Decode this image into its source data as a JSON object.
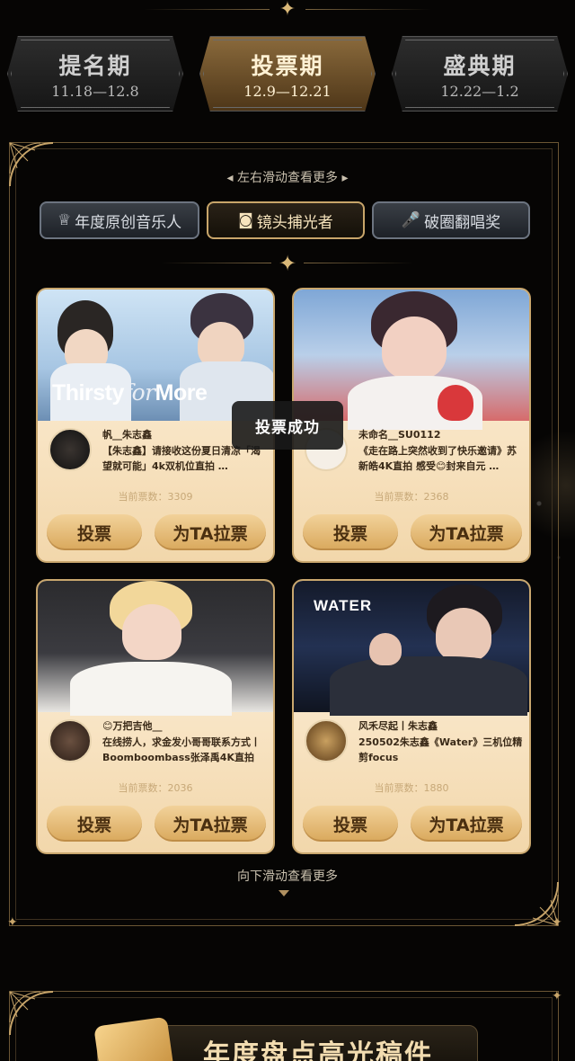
{
  "phases": [
    {
      "name": "提名期",
      "date": "11.18—12.8"
    },
    {
      "name": "投票期",
      "date": "12.9—12.21"
    },
    {
      "name": "盛典期",
      "date": "12.22—1.2"
    }
  ],
  "hint_top": "左右滑动查看更多",
  "categories": [
    {
      "label": "年度原创音乐人",
      "icon": "trophy-icon"
    },
    {
      "label": "镜头捕光者",
      "icon": "camera-icon"
    },
    {
      "label": "破圈翻唱奖",
      "icon": "microphone-icon"
    }
  ],
  "cards": [
    {
      "author": "帆__朱志鑫",
      "desc": "【朱志鑫】请接收这份夏日清凉「渴望就可能」4k双机位直拍 …",
      "votes": "当前票数：3309",
      "poster_text_a": "Thirsty",
      "poster_text_b": "for",
      "poster_text_c": "More",
      "vote_label": "投票",
      "pull_label": "为TA拉票"
    },
    {
      "author": "未命名__SU0112",
      "desc": "《走在路上突然收到了快乐邀请》苏新皓4K直拍 感受😊封来自元 …",
      "votes": "当前票数：2368",
      "vote_label": "投票",
      "pull_label": "为TA拉票"
    },
    {
      "author": "😊万把吉他__",
      "desc": "在线捞人，求金发小哥哥联系方式丨Boomboombass张泽禹4K直拍",
      "votes": "当前票数：2036",
      "vote_label": "投票",
      "pull_label": "为TA拉票"
    },
    {
      "author": "风禾尽起丨朱志鑫",
      "desc": "250502朱志鑫《Water》三机位精剪focus",
      "votes": "当前票数：1880",
      "poster_text_a": "WATER",
      "vote_label": "投票",
      "pull_label": "为TA拉票"
    }
  ],
  "toast": "投票成功",
  "hint_bottom": "向下滑动查看更多",
  "section2_title": "年度盘点高光稿件"
}
